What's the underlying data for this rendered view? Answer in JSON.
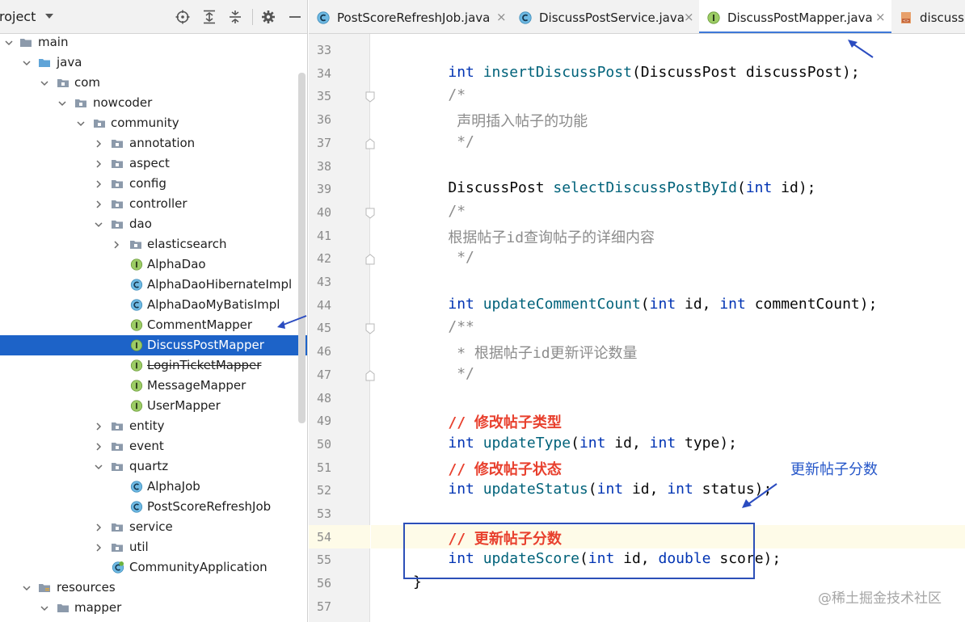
{
  "project_panel": {
    "title": "roject",
    "toolbar": [
      "locate-icon",
      "expand-all-icon",
      "collapse-all-icon",
      "gear-icon",
      "hide-icon"
    ],
    "tree": [
      {
        "label": "main",
        "type": "folder",
        "state": "expanded"
      },
      {
        "label": "java",
        "type": "source-folder",
        "state": "expanded"
      },
      {
        "label": "com",
        "type": "package",
        "state": "expanded"
      },
      {
        "label": "nowcoder",
        "type": "package",
        "state": "expanded"
      },
      {
        "label": "community",
        "type": "package",
        "state": "expanded"
      },
      {
        "label": "annotation",
        "type": "package",
        "state": "collapsed"
      },
      {
        "label": "aspect",
        "type": "package",
        "state": "collapsed"
      },
      {
        "label": "config",
        "type": "package",
        "state": "collapsed"
      },
      {
        "label": "controller",
        "type": "package",
        "state": "collapsed"
      },
      {
        "label": "dao",
        "type": "package",
        "state": "expanded"
      },
      {
        "label": "elasticsearch",
        "type": "package",
        "state": "collapsed"
      },
      {
        "label": "AlphaDao",
        "type": "interface"
      },
      {
        "label": "AlphaDaoHibernateImpl",
        "type": "class"
      },
      {
        "label": "AlphaDaoMyBatisImpl",
        "type": "class"
      },
      {
        "label": "CommentMapper",
        "type": "interface"
      },
      {
        "label": "DiscussPostMapper",
        "type": "interface",
        "selected": true
      },
      {
        "label": "LoginTicketMapper",
        "type": "interface",
        "deprecated": true
      },
      {
        "label": "MessageMapper",
        "type": "interface"
      },
      {
        "label": "UserMapper",
        "type": "interface"
      },
      {
        "label": "entity",
        "type": "package",
        "state": "collapsed"
      },
      {
        "label": "event",
        "type": "package",
        "state": "collapsed"
      },
      {
        "label": "quartz",
        "type": "package",
        "state": "expanded"
      },
      {
        "label": "AlphaJob",
        "type": "class"
      },
      {
        "label": "PostScoreRefreshJob",
        "type": "class"
      },
      {
        "label": "service",
        "type": "package",
        "state": "collapsed"
      },
      {
        "label": "util",
        "type": "package",
        "state": "collapsed"
      },
      {
        "label": "CommunityApplication",
        "type": "spring-class"
      },
      {
        "label": "resources",
        "type": "resources-folder",
        "state": "expanded"
      },
      {
        "label": "mapper",
        "type": "folder",
        "state": "expanded"
      }
    ]
  },
  "tabs": [
    {
      "label": "PostScoreRefreshJob.java",
      "icon": "class-icon",
      "active": false,
      "close": "×"
    },
    {
      "label": "DiscussPostService.java",
      "icon": "class-icon",
      "active": false,
      "close": "×"
    },
    {
      "label": "DiscussPostMapper.java",
      "icon": "interface-icon",
      "active": true,
      "close": "×"
    },
    {
      "label": "discussp",
      "icon": "xml-icon",
      "active": false
    }
  ],
  "editor": {
    "line_numbers": [
      "33",
      "34",
      "35",
      "36",
      "37",
      "38",
      "39",
      "40",
      "41",
      "42",
      "43",
      "44",
      "45",
      "46",
      "47",
      "48",
      "49",
      "50",
      "51",
      "52",
      "53",
      "54",
      "55",
      "56",
      "57"
    ],
    "lines": [
      [],
      [
        {
          "t": "    "
        },
        {
          "t": "int",
          "c": "kw"
        },
        {
          "t": " "
        },
        {
          "t": "insertDiscussPost",
          "c": "mth"
        },
        {
          "t": "(DiscussPost discussPost);"
        }
      ],
      [
        {
          "t": "    "
        },
        {
          "t": "/*",
          "c": "cmt"
        }
      ],
      [
        {
          "t": "     "
        },
        {
          "t": "声明插入帖子的功能",
          "c": "cmt"
        }
      ],
      [
        {
          "t": "     "
        },
        {
          "t": "*/",
          "c": "cmt"
        }
      ],
      [],
      [
        {
          "t": "    DiscussPost "
        },
        {
          "t": "selectDiscussPostById",
          "c": "mth"
        },
        {
          "t": "("
        },
        {
          "t": "int",
          "c": "kw"
        },
        {
          "t": " id);"
        }
      ],
      [
        {
          "t": "    "
        },
        {
          "t": "/*",
          "c": "cmt"
        }
      ],
      [
        {
          "t": "    "
        },
        {
          "t": "根据帖子id查询帖子的详细内容",
          "c": "cmt"
        }
      ],
      [
        {
          "t": "     "
        },
        {
          "t": "*/",
          "c": "cmt"
        }
      ],
      [],
      [
        {
          "t": "    "
        },
        {
          "t": "int",
          "c": "kw"
        },
        {
          "t": " "
        },
        {
          "t": "updateCommentCount",
          "c": "mth"
        },
        {
          "t": "("
        },
        {
          "t": "int",
          "c": "kw"
        },
        {
          "t": " id, "
        },
        {
          "t": "int",
          "c": "kw"
        },
        {
          "t": " commentCount);"
        }
      ],
      [
        {
          "t": "    "
        },
        {
          "t": "/**",
          "c": "cmt"
        }
      ],
      [
        {
          "t": "     "
        },
        {
          "t": "* 根据帖子id更新评论数量",
          "c": "cmt"
        }
      ],
      [
        {
          "t": "     "
        },
        {
          "t": "*/",
          "c": "cmt"
        }
      ],
      [],
      [
        {
          "t": "    "
        },
        {
          "t": "// 修改帖子类型",
          "c": "lcmt"
        }
      ],
      [
        {
          "t": "    "
        },
        {
          "t": "int",
          "c": "kw"
        },
        {
          "t": " "
        },
        {
          "t": "updateType",
          "c": "mth"
        },
        {
          "t": "("
        },
        {
          "t": "int",
          "c": "kw"
        },
        {
          "t": " id, "
        },
        {
          "t": "int",
          "c": "kw"
        },
        {
          "t": " type);"
        }
      ],
      [
        {
          "t": "    "
        },
        {
          "t": "// 修改帖子状态",
          "c": "lcmt"
        }
      ],
      [
        {
          "t": "    "
        },
        {
          "t": "int",
          "c": "kw"
        },
        {
          "t": " "
        },
        {
          "t": "updateStatus",
          "c": "mth"
        },
        {
          "t": "("
        },
        {
          "t": "int",
          "c": "kw"
        },
        {
          "t": " id, "
        },
        {
          "t": "int",
          "c": "kw"
        },
        {
          "t": " status);"
        }
      ],
      [],
      [
        {
          "t": "    "
        },
        {
          "t": "// 更新帖子分数",
          "c": "lcmt"
        }
      ],
      [
        {
          "t": "    "
        },
        {
          "t": "int",
          "c": "kw"
        },
        {
          "t": " "
        },
        {
          "t": "updateScore",
          "c": "mth"
        },
        {
          "t": "("
        },
        {
          "t": "int",
          "c": "kw"
        },
        {
          "t": " id, "
        },
        {
          "t": "double",
          "c": "kw"
        },
        {
          "t": " score);"
        }
      ],
      [
        {
          "t": "}"
        }
      ],
      []
    ]
  },
  "annotation": {
    "note": "更新帖子分数",
    "color": "#2657c9"
  },
  "watermark": "@稀土掘金技术社区",
  "colors": {
    "selection": "#1d63c8",
    "keyword": "#0033b3",
    "method": "#00627a",
    "comment": "#8c8c8c",
    "line_comment": "#e8402e",
    "tab_underline": "#3d78d8"
  }
}
